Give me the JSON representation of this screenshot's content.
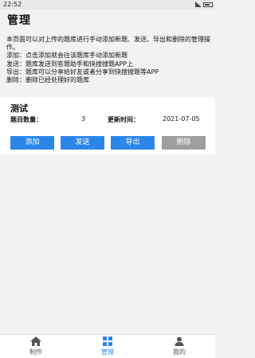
{
  "status_bar": {
    "time": "22:52"
  },
  "page": {
    "title": "管理",
    "intro_lines": [
      "本页面可以对上传的题库进行手动添加新题、发送、导出和删除的管理操作。",
      "添加：点击添加就会往该题库手动添加新题",
      "发送：题库发送到答题助手和快搜搜题APP上",
      "导出：题库可以分享给好友或者分享到快搜搜题等APP",
      "删除：删除已经处理好的题库"
    ]
  },
  "bank": {
    "title": "测试",
    "count_label": "题目数量：",
    "count_value": "3",
    "update_label": "更新时间：",
    "update_value": "2021-07-05"
  },
  "actions": {
    "add": "添加",
    "send": "发送",
    "export": "导出",
    "delete": "删除"
  },
  "nav": {
    "items": [
      {
        "label": "制作",
        "icon": "home-icon"
      },
      {
        "label": "管理",
        "icon": "grid-icon"
      },
      {
        "label": "我的",
        "icon": "person-icon"
      }
    ]
  },
  "colors": {
    "accent": "#2b86e8",
    "disabled": "#9e9e9e"
  }
}
